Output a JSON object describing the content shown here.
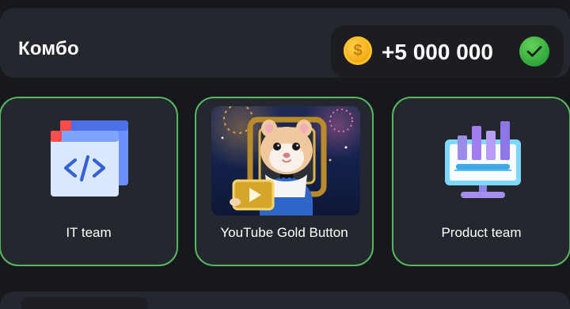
{
  "header": {
    "title": "Комбо",
    "reward_text": "+5 000 000"
  },
  "cards": [
    {
      "label": "IT team",
      "icon": "code-window-icon"
    },
    {
      "label": "YouTube Gold Button",
      "icon": "hamster-youtube-gold-button-image"
    },
    {
      "label": "Product team",
      "icon": "monitor-bar-chart-icon"
    }
  ],
  "colors": {
    "background": "#16181c",
    "panel": "#24272d",
    "accent_green": "#55b861",
    "coin": "#f5b117",
    "check": "#2fa73a"
  }
}
